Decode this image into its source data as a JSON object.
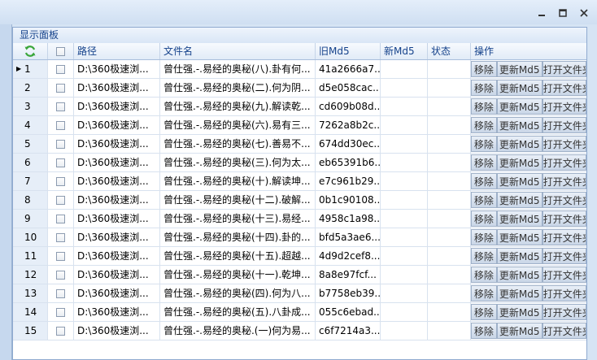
{
  "window": {
    "controls": [
      {
        "name": "minimize-icon",
        "glyph": "—"
      },
      {
        "name": "restore-icon",
        "glyph": "□"
      },
      {
        "name": "close-icon",
        "glyph": "✕"
      }
    ]
  },
  "panel": {
    "title": "显示面板"
  },
  "grid": {
    "columns": {
      "refresh_icon": "refresh-icon",
      "path": "路径",
      "filename": "文件名",
      "old_md5": "旧Md5",
      "new_md5": "新Md5",
      "status": "状态",
      "ops": "操作"
    },
    "selected_row": 1,
    "rows": [
      {
        "idx": "1",
        "path": "D:\\360极速浏...",
        "name": "曾仕强.-.易经的奥秘(八).卦有何...",
        "old": "41a2666a7...",
        "new": "",
        "status": "",
        "btn_move": "移除",
        "btn_update": "更新Md5",
        "btn_open": "打开文件夹"
      },
      {
        "idx": "2",
        "path": "D:\\360极速浏...",
        "name": "曾仕强.-.易经的奥秘(二).何为阴...",
        "old": "d5e058cac...",
        "new": "",
        "status": "",
        "btn_move": "移除",
        "btn_update": "更新Md5",
        "btn_open": "打开文件夹"
      },
      {
        "idx": "3",
        "path": "D:\\360极速浏...",
        "name": "曾仕强.-.易经的奥秘(九).解读乾...",
        "old": "cd609b08d...",
        "new": "",
        "status": "",
        "btn_move": "移除",
        "btn_update": "更新Md5",
        "btn_open": "打开文件夹"
      },
      {
        "idx": "4",
        "path": "D:\\360极速浏...",
        "name": "曾仕强.-.易经的奥秘(六).易有三...",
        "old": "7262a8b2c...",
        "new": "",
        "status": "",
        "btn_move": "移除",
        "btn_update": "更新Md5",
        "btn_open": "打开文件夹"
      },
      {
        "idx": "5",
        "path": "D:\\360极速浏...",
        "name": "曾仕强.-.易经的奥秘(七).善易不...",
        "old": "674dd30ec...",
        "new": "",
        "status": "",
        "btn_move": "移除",
        "btn_update": "更新Md5",
        "btn_open": "打开文件夹"
      },
      {
        "idx": "6",
        "path": "D:\\360极速浏...",
        "name": "曾仕强.-.易经的奥秘(三).何为太...",
        "old": "eb65391b6...",
        "new": "",
        "status": "",
        "btn_move": "移除",
        "btn_update": "更新Md5",
        "btn_open": "打开文件夹"
      },
      {
        "idx": "7",
        "path": "D:\\360极速浏...",
        "name": "曾仕强.-.易经的奥秘(十).解读坤...",
        "old": "e7c961b29...",
        "new": "",
        "status": "",
        "btn_move": "移除",
        "btn_update": "更新Md5",
        "btn_open": "打开文件夹"
      },
      {
        "idx": "8",
        "path": "D:\\360极速浏...",
        "name": "曾仕强.-.易经的奥秘(十二).破解...",
        "old": "0b1c90108...",
        "new": "",
        "status": "",
        "btn_move": "移除",
        "btn_update": "更新Md5",
        "btn_open": "打开文件夹"
      },
      {
        "idx": "9",
        "path": "D:\\360极速浏...",
        "name": "曾仕强.-.易经的奥秘(十三).易经...",
        "old": "4958c1a98...",
        "new": "",
        "status": "",
        "btn_move": "移除",
        "btn_update": "更新Md5",
        "btn_open": "打开文件夹"
      },
      {
        "idx": "10",
        "path": "D:\\360极速浏...",
        "name": "曾仕强.-.易经的奥秘(十四).卦的...",
        "old": "bfd5a3ae6...",
        "new": "",
        "status": "",
        "btn_move": "移除",
        "btn_update": "更新Md5",
        "btn_open": "打开文件夹"
      },
      {
        "idx": "11",
        "path": "D:\\360极速浏...",
        "name": "曾仕强.-.易经的奥秘(十五).超越...",
        "old": "4d9d2cef8...",
        "new": "",
        "status": "",
        "btn_move": "移除",
        "btn_update": "更新Md5",
        "btn_open": "打开文件夹"
      },
      {
        "idx": "12",
        "path": "D:\\360极速浏...",
        "name": "曾仕强.-.易经的奥秘(十一).乾坤...",
        "old": "8a8e97fcf...",
        "new": "",
        "status": "",
        "btn_move": "移除",
        "btn_update": "更新Md5",
        "btn_open": "打开文件夹"
      },
      {
        "idx": "13",
        "path": "D:\\360极速浏...",
        "name": "曾仕强.-.易经的奥秘(四).何为八...",
        "old": "b7758eb39...",
        "new": "",
        "status": "",
        "btn_move": "移除",
        "btn_update": "更新Md5",
        "btn_open": "打开文件夹"
      },
      {
        "idx": "14",
        "path": "D:\\360极速浏...",
        "name": "曾仕强.-.易经的奥秘(五).八卦成...",
        "old": "055c6ebad...",
        "new": "",
        "status": "",
        "btn_move": "移除",
        "btn_update": "更新Md5",
        "btn_open": "打开文件夹"
      },
      {
        "idx": "15",
        "path": "D:\\360极速浏...",
        "name": "曾仕强.-.易经的奥秘.(一)何为易...",
        "old": "c6f7214a3...",
        "new": "",
        "status": "",
        "btn_move": "移除",
        "btn_update": "更新Md5",
        "btn_open": "打开文件夹"
      }
    ]
  },
  "colors": {
    "accent": "#15428b",
    "refresh_green": "#3aa63a"
  }
}
